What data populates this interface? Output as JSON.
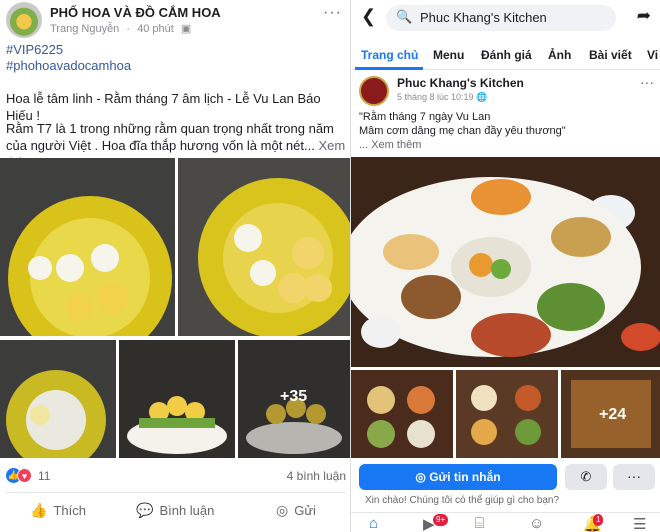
{
  "left_post": {
    "page_name": "PHỐ HOA VÀ ĐỒ CẮM HOA",
    "author": "Trang Nguyễn",
    "time": "40 phút",
    "privacy_icon": "group-icon",
    "more": "···",
    "hashtag1": "#VIP6225",
    "hashtag2": "#phohoavadocamhoa",
    "line1": "Hoa lễ tâm linh - Rằm tháng 7 âm lịch - Lễ Vu Lan Báo Hiếu !",
    "line2": "Rằm T7 là 1 trong những rằm quan trọng nhất trong năm của người Việt . Hoa đĩa thắp hương vốn là một nét...",
    "see_more": "Xem thêm",
    "extra_photos": "+35",
    "reaction_count": "11",
    "comment_count": "4 bình luận",
    "actions": {
      "like": "Thích",
      "comment": "Bình luận",
      "share": "Gửi"
    }
  },
  "right_page": {
    "search_text": "Phuc Khang's Kitchen",
    "tabs": [
      "Trang chủ",
      "Menu",
      "Đánh giá",
      "Ảnh",
      "Bài viết",
      "Vi"
    ],
    "post": {
      "author": "Phuc Khang's Kitchen",
      "date": "5 tháng 8 lúc 10:19",
      "privacy_icon": "globe-icon",
      "more": "···",
      "line1": "\"Rằm tháng 7 ngày Vu Lan",
      "line2": "Mâm cơm dâng mẹ chan đầy yêu thương\"",
      "see_more": "... Xem thêm",
      "extra_photos": "+24"
    },
    "message_button": "Gửi tin nhắn",
    "chat_hint": "Xin chào! Chúng tôi có thể giúp gì cho bạn?",
    "nav_badges": {
      "video": "9+",
      "notifications": "1"
    }
  },
  "colors": {
    "accent": "#1877f2",
    "link": "#385898",
    "muted": "#65676b"
  }
}
